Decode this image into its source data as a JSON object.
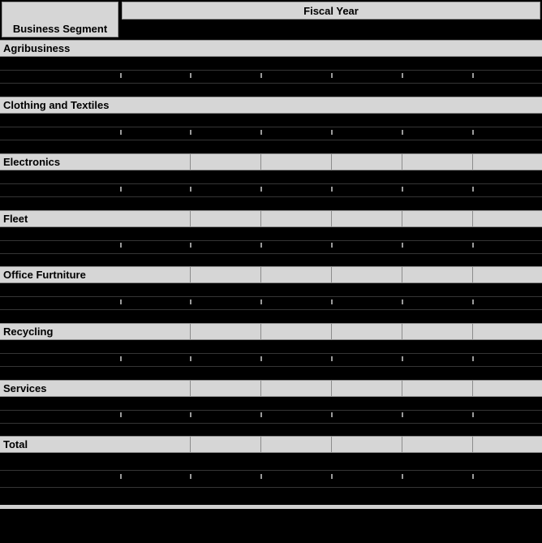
{
  "header": {
    "segment_label": "Business Segment",
    "fiscal_label": "Fiscal Year"
  },
  "segments": [
    {
      "name": "Agribusiness"
    },
    {
      "name": "Clothing and Textiles"
    },
    {
      "name": "Electronics"
    },
    {
      "name": "Fleet"
    },
    {
      "name": "Office Furtniture"
    },
    {
      "name": "Recycling"
    },
    {
      "name": "Services"
    },
    {
      "name": "Total"
    }
  ],
  "colors": {
    "header_fill": "#d6d6d6",
    "grid_line": "#8c8c8c",
    "redaction": "#000000"
  }
}
